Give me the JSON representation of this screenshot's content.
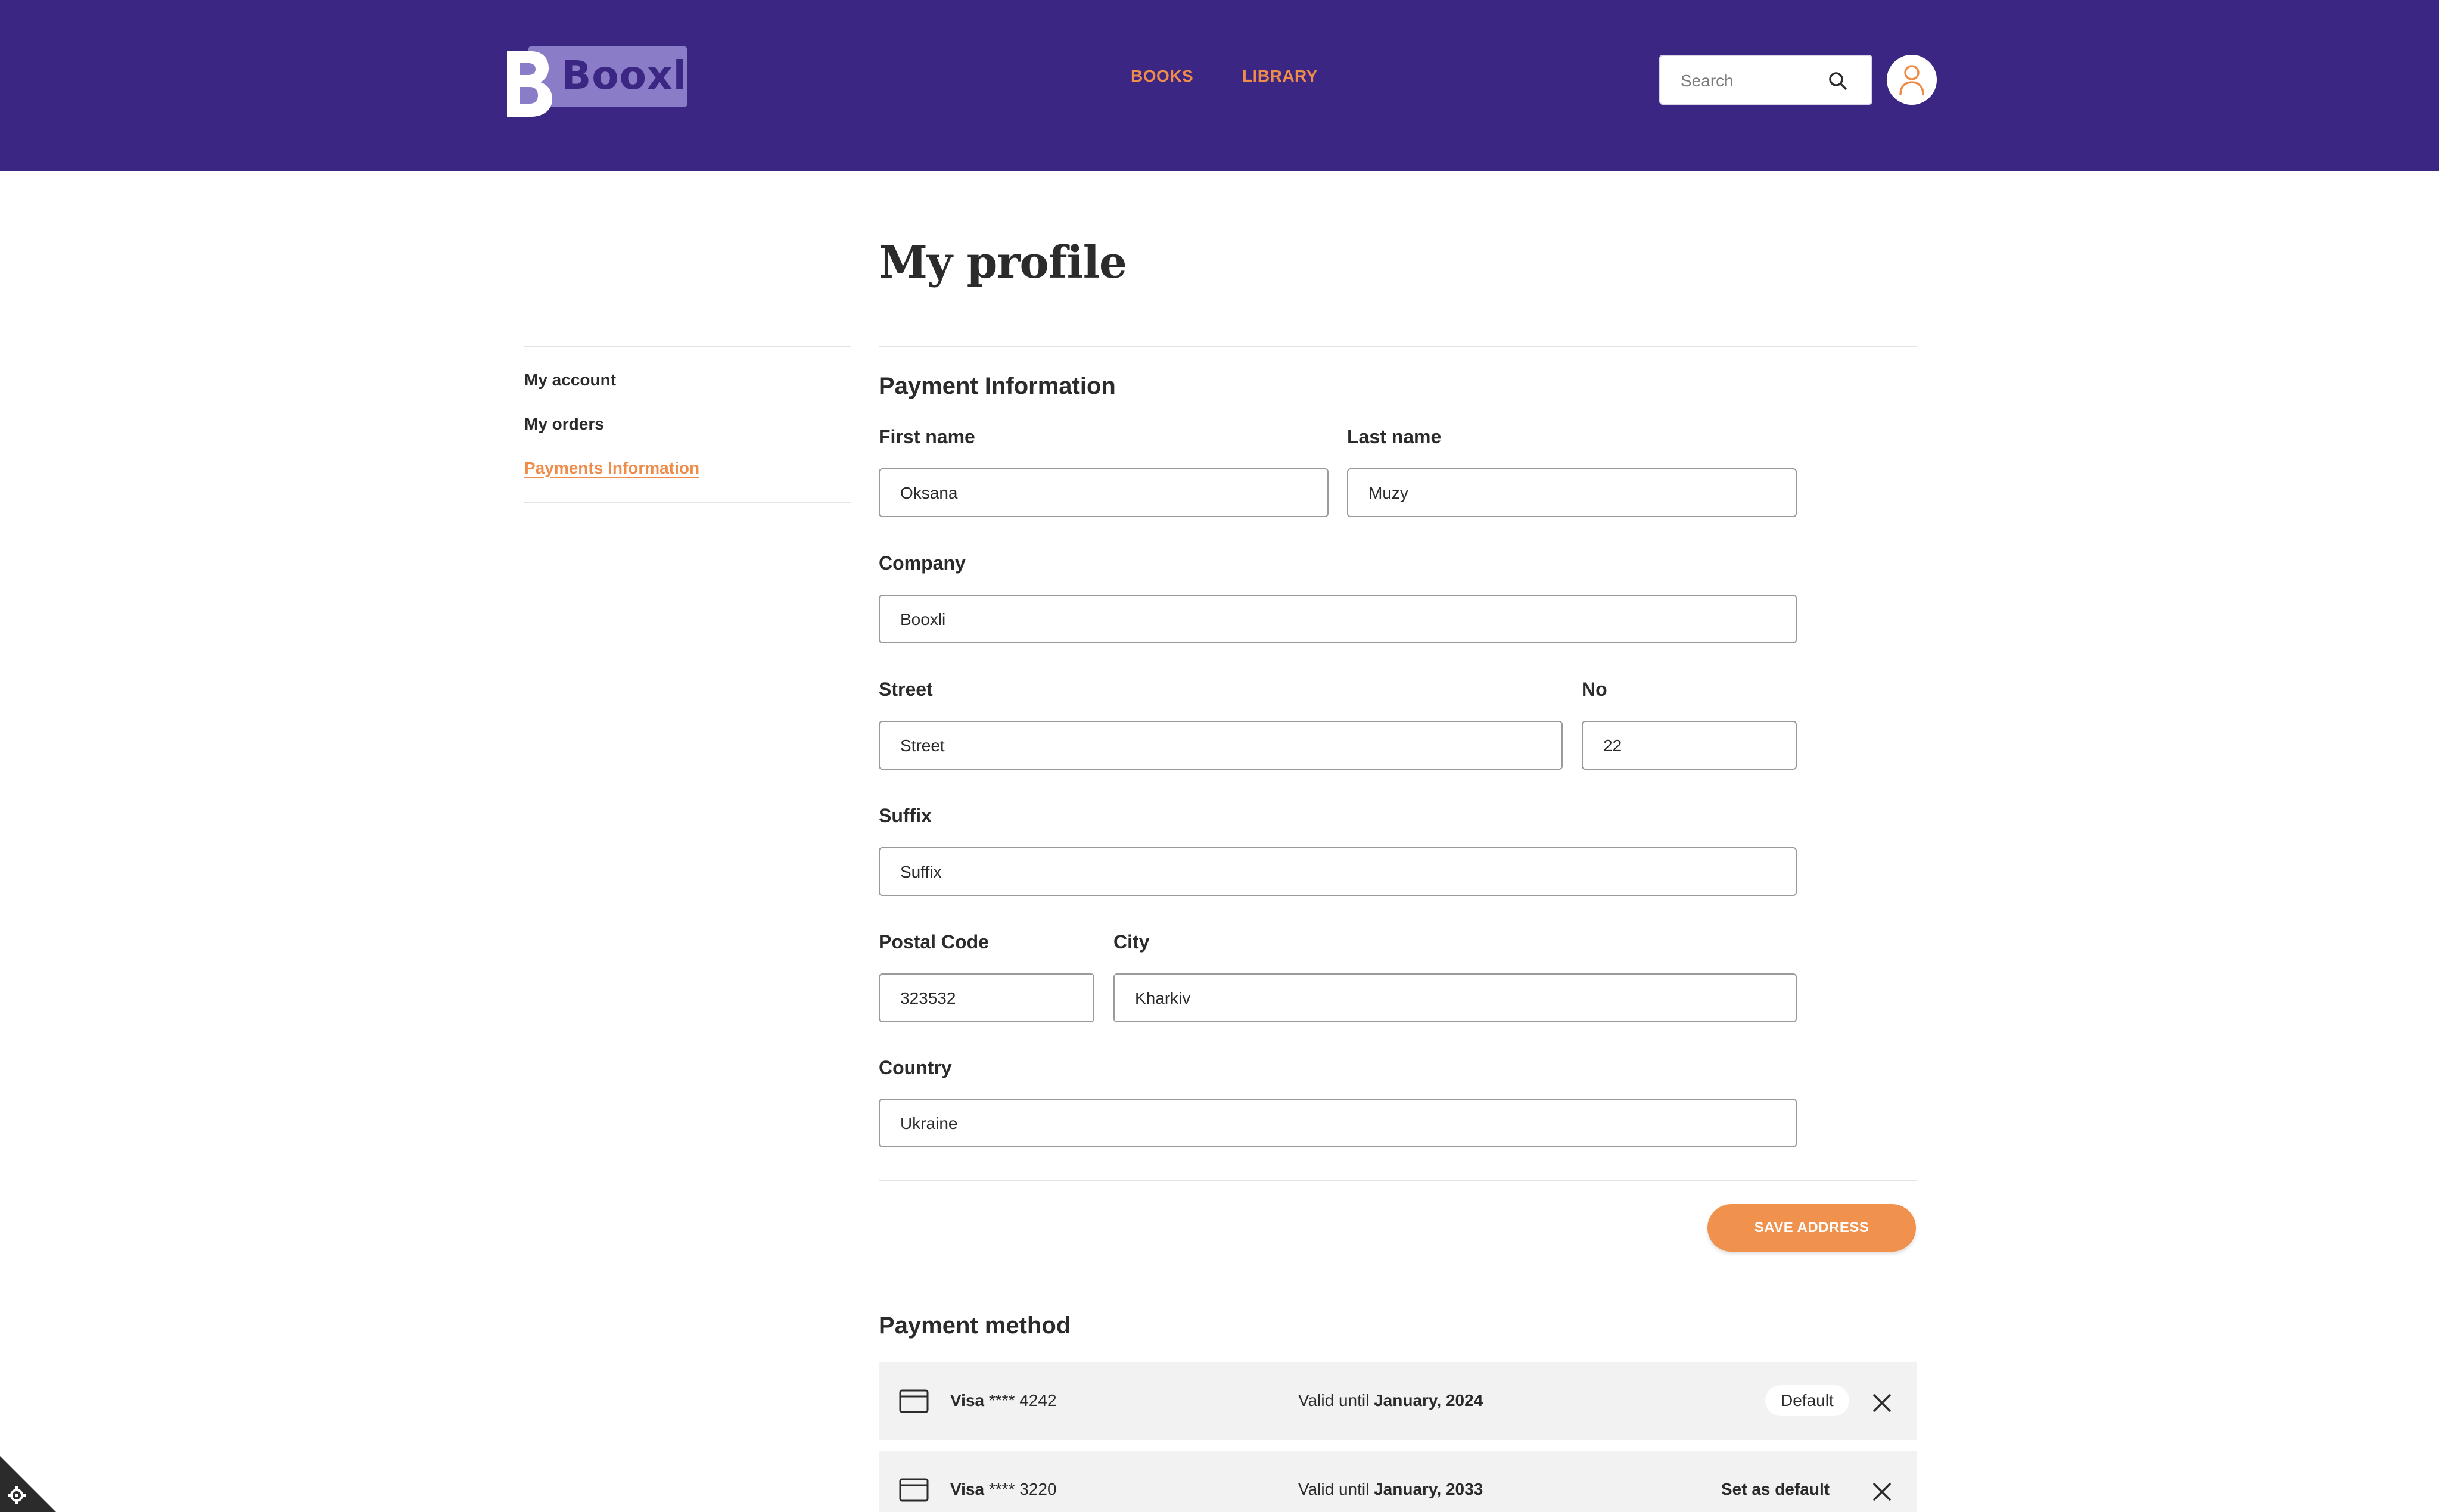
{
  "header": {
    "logo_text": "Booxli",
    "nav": [
      {
        "label": "BOOKS"
      },
      {
        "label": "LIBRARY"
      }
    ],
    "search": {
      "placeholder": "Search",
      "value": ""
    },
    "icons": [
      "search-icon",
      "user-icon"
    ]
  },
  "page": {
    "title": "My profile"
  },
  "sidebar": {
    "items": [
      {
        "label": "My account",
        "active": false
      },
      {
        "label": "My orders",
        "active": false
      },
      {
        "label": "Payments Information",
        "active": true
      }
    ]
  },
  "payment_info": {
    "title": "Payment Information",
    "fields": {
      "first_name": {
        "label": "First name",
        "value": "Oksana"
      },
      "last_name": {
        "label": "Last name",
        "value": "Muzy"
      },
      "company": {
        "label": "Company",
        "value": "Booxli"
      },
      "street": {
        "label": "Street",
        "value": "Street"
      },
      "no": {
        "label": "No",
        "value": "22"
      },
      "suffix": {
        "label": "Suffix",
        "value": "Suffix"
      },
      "postal_code": {
        "label": "Postal Code",
        "value": "323532"
      },
      "city": {
        "label": "City",
        "value": "Kharkiv"
      },
      "country": {
        "label": "Country",
        "value": "Ukraine"
      }
    },
    "save_label": "SAVE ADDRESS"
  },
  "payment_method": {
    "title": "Payment method",
    "valid_prefix": "Valid until",
    "cards": [
      {
        "brand": "Visa",
        "masked": "**** 4242",
        "valid_until": "January, 2024",
        "is_default": true,
        "default_label": "Default"
      },
      {
        "brand": "Visa",
        "masked": "**** 3220",
        "valid_until": "January, 2033",
        "is_default": false,
        "set_default_label": "Set as default"
      }
    ]
  },
  "colors": {
    "header_bg": "#3b2783",
    "accent": "#f08c4a",
    "logo_box": "#8b7cc8",
    "row_bg": "#f2f2f2"
  }
}
